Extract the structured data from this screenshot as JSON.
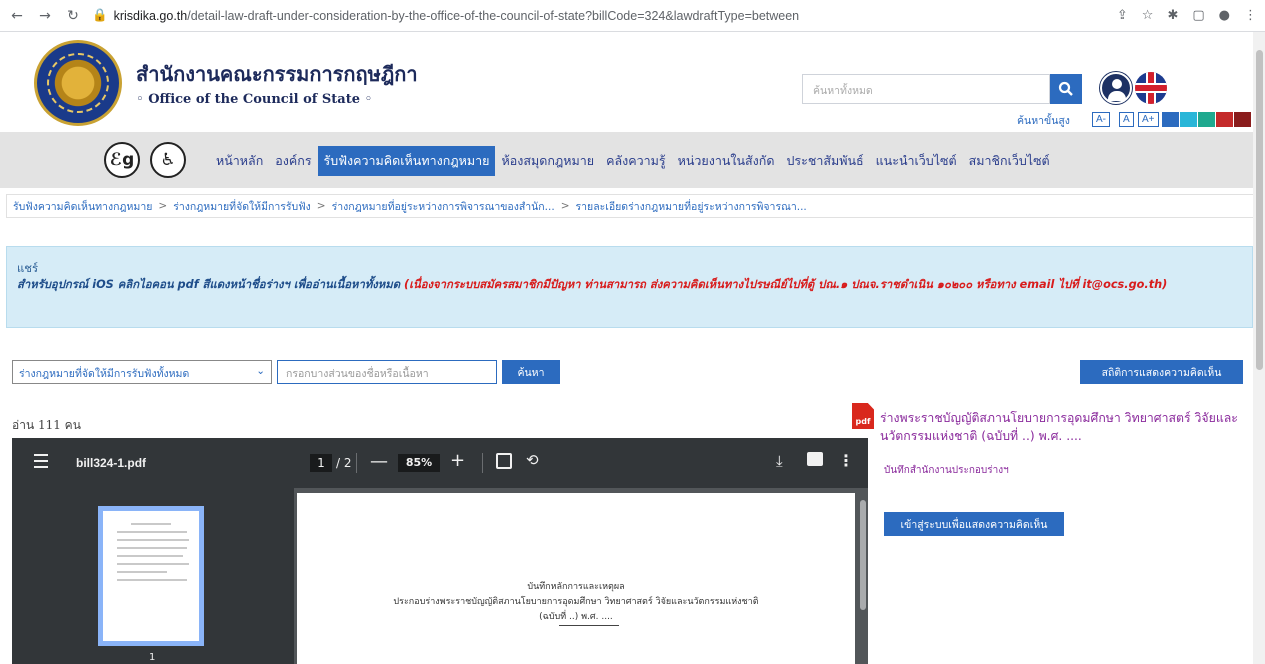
{
  "browser": {
    "url_host": "krisdika.go.th",
    "url_path": "/detail-law-draft-under-consideration-by-the-office-of-the-council-of-state?billCode=324&lawdraftType=between"
  },
  "header": {
    "title_th": "สำนักงานคณะกรรมการกฤษฎีกา",
    "title_en": "◦ Office of the Council of State ◦",
    "search_placeholder": "ค้นหาทั้งหมด",
    "advanced_search": "ค้นหาขั้นสูง",
    "font_sizes": [
      "A-",
      "A",
      "A+"
    ],
    "theme_colors": [
      "#2c6bbf",
      "#29b6d8",
      "#1fa98f",
      "#c42a2a",
      "#8a1c1c"
    ]
  },
  "nav": {
    "items": [
      "หน้าหลัก",
      "องค์กร",
      "รับฟังความคิดเห็นทางกฎหมาย",
      "ห้องสมุดกฎหมาย",
      "คลังความรู้",
      "หน่วยงานในสังกัด",
      "ประชาสัมพันธ์",
      "แนะนำเว็บไซต์",
      "สมาชิกเว็บไซต์"
    ],
    "active_index": 2
  },
  "breadcrumb": [
    "รับฟังความคิดเห็นทางกฎหมาย",
    "ร่างกฎหมายที่จัดให้มีการรับฟัง",
    "ร่างกฎหมายที่อยู่ระหว่างการพิจารณาของสำนัก...",
    "รายละเอียดร่างกฎหมายที่อยู่ระหว่างการพิจารณา..."
  ],
  "notice": {
    "label": "แชร์",
    "blue_text": "สำหรับอุปกรณ์ iOS คลิกไอคอน pdf สีแดงหน้าชื่อร่างฯ เพื่ออ่านเนื้อหาทั้งหมด ",
    "red_text": "(เนื่องจากระบบสมัครสมาชิกมีปัญหา ท่านสามารถ ส่งความคิดเห็นทางไปรษณีย์ไปที่ตู้ ปณ.๑ ปณจ.ราชดำเนิน ๑๐๒๐๐ หรือทาง email ไปที่ it@ocs.go.th)"
  },
  "filter": {
    "select_value": "ร่างกฎหมายที่จัดให้มีการรับฟังทั้งหมด",
    "input_placeholder": "กรอกบางส่วนของชื่อหรือเนื้อหา",
    "search_button": "ค้นหา",
    "stats_button": "สถิติการแสดงความคิดเห็น"
  },
  "reads": "อ่าน 111 คน",
  "pdf_viewer": {
    "file_name": "bill324-1.pdf",
    "current_page": "1",
    "total_pages": "/ 2",
    "zoom": "85%",
    "thumbnail_page": "1",
    "page_heading": "บันทึกหลักการและเหตุผล",
    "page_line1": "ประกอบร่างพระราชบัญญัติสภานโยบายการอุดมศึกษา วิทยาศาสตร์ วิจัยและนวัตกรรมแห่งชาติ",
    "page_line2": "(ฉบับที่ ..) พ.ศ. ...."
  },
  "side": {
    "pdf_icon_label": "pdf",
    "bill_title": "ร่างพระราชบัญญัติสภานโยบายการอุดมศึกษา วิทยาศาสตร์ วิจัยและนวัตกรรมแห่งชาติ (ฉบับที่ ..) พ.ศ. ....",
    "bill_subtitle": "บันทึกสำนักงานประกอบร่างฯ",
    "login_button": "เข้าสู่ระบบเพื่อแสดงความคิดเห็น"
  },
  "icons": {
    "accessibility_1": "sign-language-icon",
    "accessibility_2": "accessibility-person-icon"
  }
}
